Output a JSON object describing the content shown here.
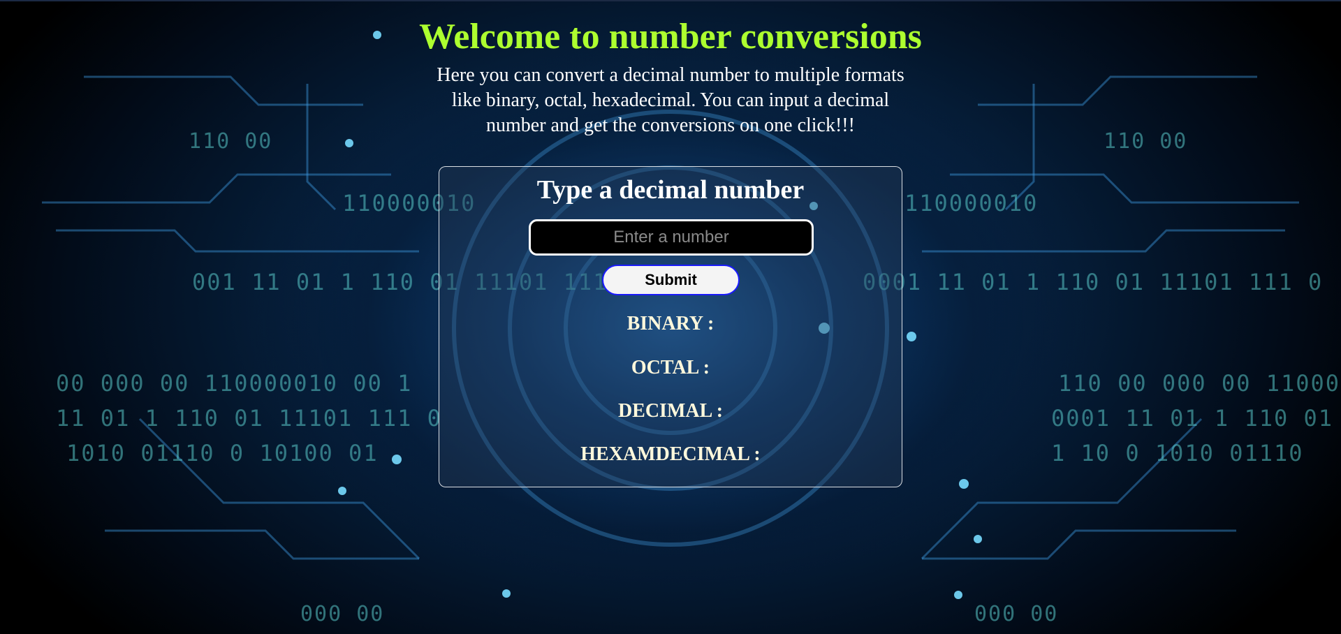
{
  "header": {
    "title": "Welcome to number conversions",
    "intro": "Here you can convert a decimal number to multiple formats like binary, octal, hexadecimal. You can input a decimal number and get the conversions on one click!!!"
  },
  "form": {
    "heading": "Type a decimal number",
    "input_placeholder": "Enter a number",
    "input_value": "",
    "submit_label": "Submit"
  },
  "results": {
    "binary_label": "BINARY :",
    "octal_label": "OCTAL :",
    "decimal_label": "DECIMAL :",
    "hex_label": "HEXAMDECIMAL :"
  },
  "colors": {
    "title": "#adff2f",
    "result_text": "#fff8dc",
    "submit_border": "#1a1aff"
  }
}
